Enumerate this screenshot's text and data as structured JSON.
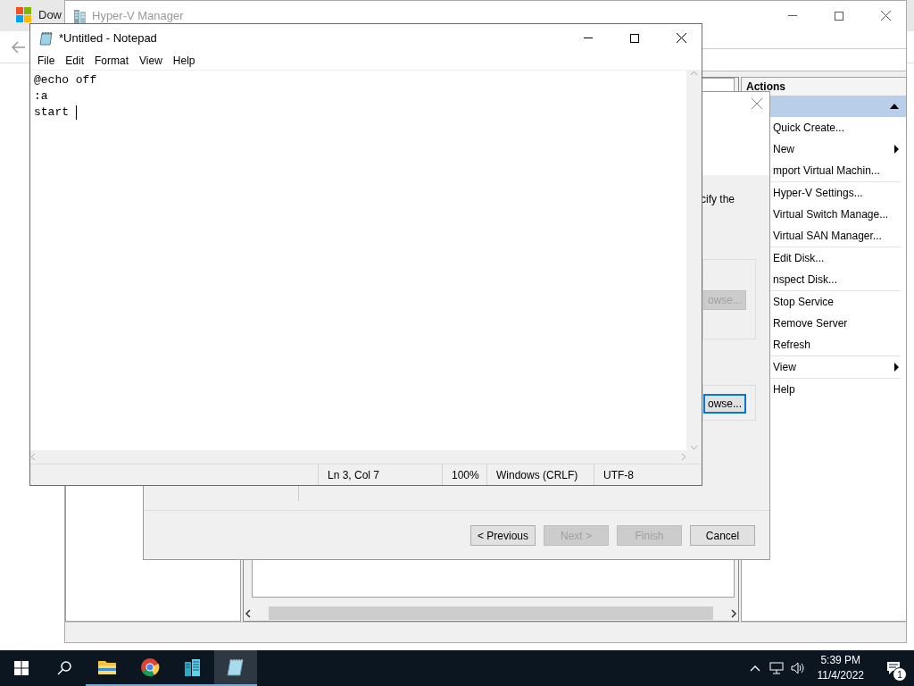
{
  "browser": {
    "tab_title": "Dow"
  },
  "hyperv": {
    "title": "Hyper-V Manager",
    "actions": {
      "header": "Actions",
      "section": {
        "expanded": true
      },
      "groups": [
        [
          {
            "label": "Quick Create...",
            "has_submenu": false
          },
          {
            "label": "New",
            "has_submenu": true
          },
          {
            "label": "mport Virtual Machin...",
            "has_submenu": false
          }
        ],
        [
          {
            "label": "Hyper-V Settings...",
            "has_submenu": false
          },
          {
            "label": "Virtual Switch Manage...",
            "has_submenu": false
          },
          {
            "label": "Virtual SAN Manager...",
            "has_submenu": false
          }
        ],
        [
          {
            "label": "Edit Disk...",
            "has_submenu": false
          },
          {
            "label": "nspect Disk...",
            "has_submenu": false
          }
        ],
        [
          {
            "label": "Stop Service",
            "has_submenu": false
          },
          {
            "label": "Remove Server",
            "has_submenu": false
          },
          {
            "label": "Refresh",
            "has_submenu": false
          }
        ],
        [
          {
            "label": "View",
            "has_submenu": true
          }
        ],
        [
          {
            "label": "Help",
            "has_submenu": false
          }
        ]
      ]
    }
  },
  "wizard": {
    "description": "cify the",
    "browse_buttons": [
      {
        "label": "owse...",
        "disabled": true,
        "focused": false
      },
      {
        "label": "owse...",
        "disabled": false,
        "focused": true
      }
    ],
    "buttons": [
      {
        "label": "< Previous",
        "disabled": false
      },
      {
        "label": "Next >",
        "disabled": true
      },
      {
        "label": "Finish",
        "disabled": true
      },
      {
        "label": "Cancel",
        "disabled": false
      }
    ]
  },
  "notepad": {
    "title": "*Untitled - Notepad",
    "menu": [
      "File",
      "Edit",
      "Format",
      "View",
      "Help"
    ],
    "lines": [
      "@echo off",
      ":a",
      "start "
    ],
    "status": {
      "position": "Ln 3, Col 7",
      "zoom": "100%",
      "line_endings": "Windows (CRLF)",
      "encoding": "UTF-8"
    }
  },
  "taskbar": {
    "apps": [
      {
        "kind": "explorer",
        "running": true,
        "active": false
      },
      {
        "kind": "chrome",
        "running": true,
        "active": false
      },
      {
        "kind": "servermanager",
        "running": true,
        "active": false
      },
      {
        "kind": "notepad",
        "running": true,
        "active": true
      }
    ],
    "time": "5:39 PM",
    "date": "11/4/2022",
    "notifications": "1"
  }
}
